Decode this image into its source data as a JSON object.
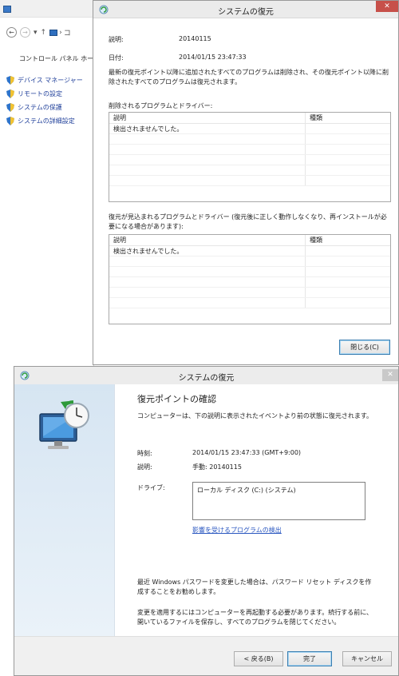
{
  "control_panel": {
    "home_label": "コントロール パネル ホーム",
    "crumb_sep": "›",
    "crumb_tail": "コ",
    "tasks": [
      {
        "label": "デバイス マネージャー"
      },
      {
        "label": "リモートの設定"
      },
      {
        "label": "システムの保護"
      },
      {
        "label": "システムの詳細設定"
      }
    ]
  },
  "details_dialog": {
    "title": "システムの復元",
    "close_glyph": "✕",
    "description_label": "説明:",
    "description_value": "20140115",
    "date_label": "日付:",
    "date_value": "2014/01/15 23:47:33",
    "info_text": "最新の復元ポイント以降に追加されたすべてのプログラムは削除され、その復元ポイント以降に削除されたすべてのプログラムは復元されます。",
    "deleted_section_label": "削除されるプログラムとドライバー:",
    "restored_section_label": "復元が見込まれるプログラムとドライバー (復元後に正しく動作しなくなり、再インストールが必要になる場合があります):",
    "grid_columns": [
      "説明",
      "種類"
    ],
    "deleted_rows": [
      "検出されませんでした。"
    ],
    "restored_rows": [
      "検出されませんでした。"
    ],
    "close_button": "閉じる(C)"
  },
  "confirm_dialog": {
    "title": "システムの復元",
    "close_glyph": "✕",
    "heading": "復元ポイントの確認",
    "subtitle": "コンピューターは、下の説明に表示されたイベントより前の状態に復元されます。",
    "time_label": "時刻:",
    "time_value": "2014/01/15 23:47:33 (GMT+9:00)",
    "description_label": "説明:",
    "description_value": "手動: 20140115",
    "drive_label": "ドライブ:",
    "drive_value": "ローカル ディスク (C:) (システム)",
    "scan_link": "影響を受けるプログラムの検出",
    "password_note": "最近 Windows パスワードを変更した場合は、パスワード リセット ディスクを作成することをお勧めします。",
    "restart_note": "変更を適用するにはコンピューターを再起動する必要があります。続行する前に、開いているファイルを保存し、すべてのプログラムを閉じてください。",
    "back_button": "< 戻る(B)",
    "finish_button": "完了",
    "cancel_button": "キャンセル"
  }
}
